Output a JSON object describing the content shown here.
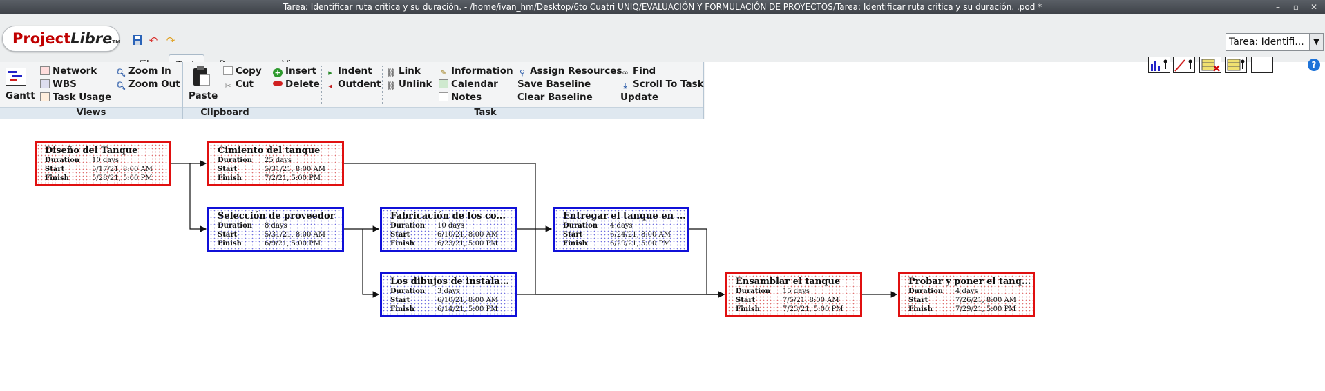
{
  "window": {
    "title": "Tarea: Identificar ruta critica y su duración.  - /home/ivan_hm/Desktop/6to Cuatri UNIQ/EVALUACIÓN Y FORMULACIÓN DE PROYECTOS/Tarea: Identificar ruta critica y su duración. .pod *"
  },
  "logo": {
    "part1": "Project",
    "part2": "Libre",
    "tm": "TM"
  },
  "menu": {
    "file": "File",
    "task": "Task",
    "resource": "Resource",
    "view": "View"
  },
  "project_selector": {
    "value": "Tarea: Identifi..."
  },
  "ribbon": {
    "views": {
      "footer": "Views",
      "gantt": "Gantt",
      "network": "Network",
      "wbs": "WBS",
      "task_usage": "Task Usage",
      "zoom_in": "Zoom In",
      "zoom_out": "Zoom Out"
    },
    "clipboard": {
      "footer": "Clipboard",
      "paste": "Paste",
      "copy": "Copy",
      "cut": "Cut"
    },
    "task": {
      "footer": "Task",
      "insert": "Insert",
      "delete": "Delete",
      "indent": "Indent",
      "outdent": "Outdent",
      "link": "Link",
      "unlink": "Unlink",
      "information": "Information",
      "calendar": "Calendar",
      "notes": "Notes",
      "assign_resources": "Assign Resources",
      "save_baseline": "Save Baseline",
      "clear_baseline": "Clear Baseline",
      "find": "Find",
      "scroll_to_task": "Scroll To Task",
      "update": "Update"
    }
  },
  "labels": {
    "duration": "Duration",
    "start": "Start",
    "finish": "Finish"
  },
  "tasks": [
    {
      "name": "Diseño del Tanque",
      "duration": "10 days",
      "start": "5/17/21, 8:00 AM",
      "finish": "5/28/21, 5:00 PM",
      "critical": true
    },
    {
      "name": "Cimiento del tanque",
      "duration": "25 days",
      "start": "5/31/21, 8:00 AM",
      "finish": "7/2/21, 5:00 PM",
      "critical": true
    },
    {
      "name": "Selección de proveedor",
      "duration": "8 days",
      "start": "5/31/21, 8:00 AM",
      "finish": "6/9/21, 5:00 PM",
      "critical": false
    },
    {
      "name": "Fabricación de los co...",
      "duration": "10 days",
      "start": "6/10/21, 8:00 AM",
      "finish": "6/23/21, 5:00 PM",
      "critical": false
    },
    {
      "name": "Entregar el tanque en ...",
      "duration": "4 days",
      "start": "6/24/21, 8:00 AM",
      "finish": "6/29/21, 5:00 PM",
      "critical": false
    },
    {
      "name": "Los dibujos de instalac...",
      "duration": "3 days",
      "start": "6/10/21, 8:00 AM",
      "finish": "6/14/21, 5:00 PM",
      "critical": false
    },
    {
      "name": "Ensamblar el tanque",
      "duration": "15 days",
      "start": "7/5/21, 8:00 AM",
      "finish": "7/23/21, 5:00 PM",
      "critical": true
    },
    {
      "name": "Probar y poner el tanq...",
      "duration": "4 days",
      "start": "7/26/21, 8:00 AM",
      "finish": "7/29/21, 5:00 PM",
      "critical": true
    }
  ],
  "colors": {
    "critical": "#e01010",
    "noncritical": "#1010d8"
  }
}
